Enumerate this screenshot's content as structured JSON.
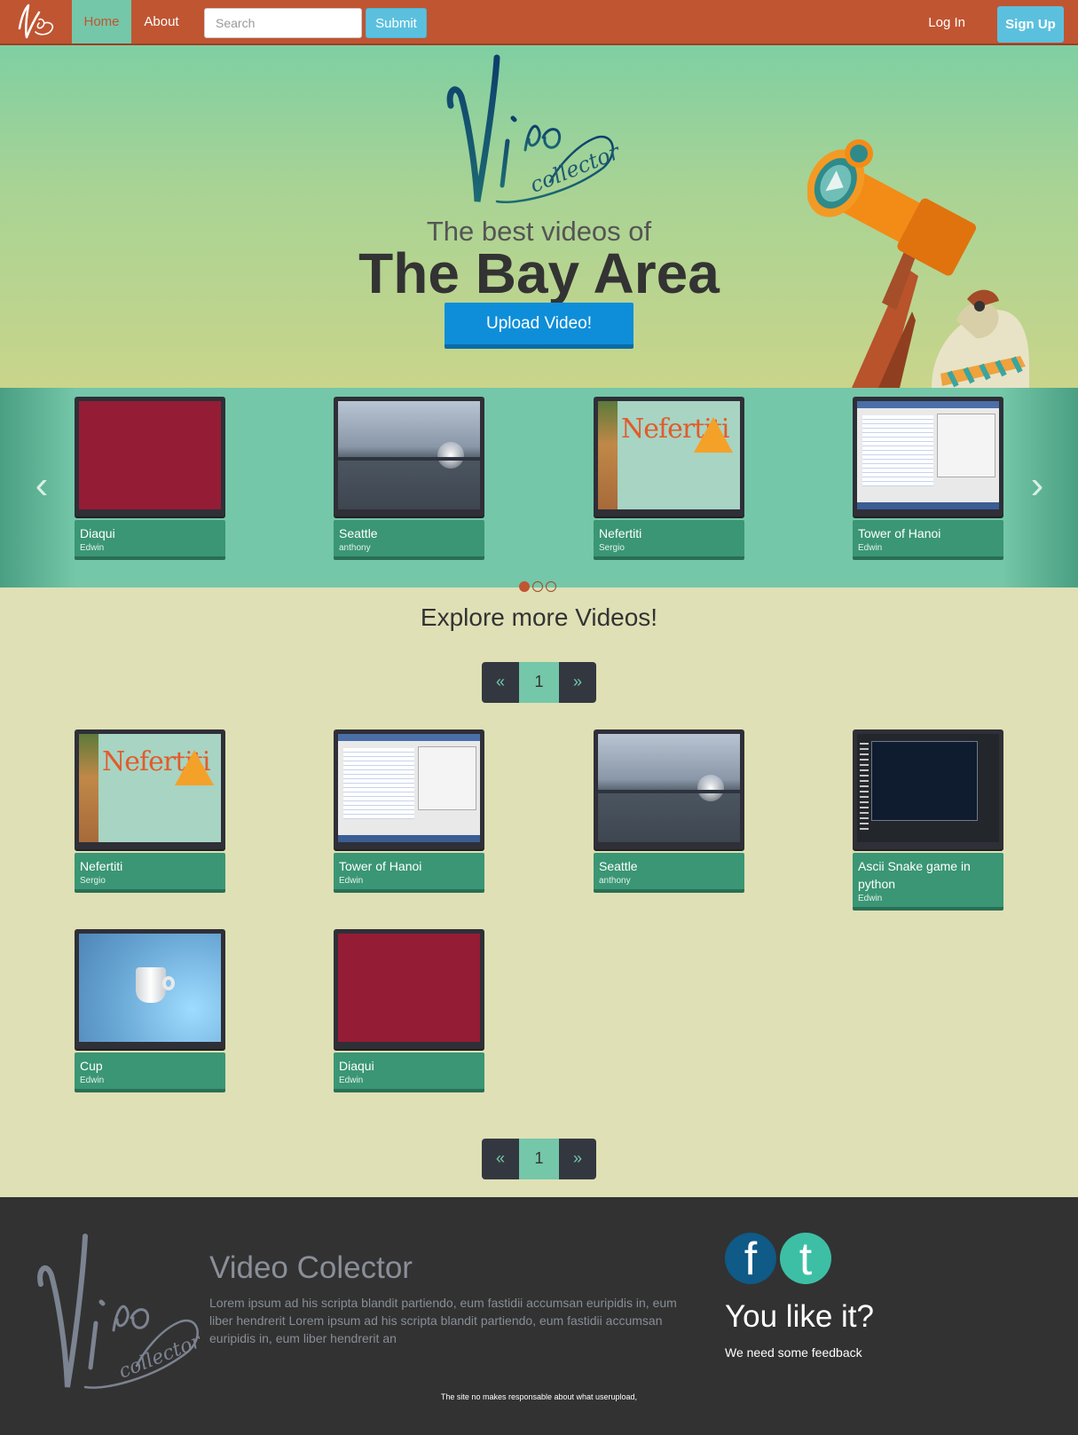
{
  "nav": {
    "home_label": "Home",
    "about_label": "About",
    "search_placeholder": "Search",
    "submit_label": "Submit",
    "login_label": "Log In",
    "signup_label": "Sign Up"
  },
  "hero": {
    "subtitle": "The best videos of",
    "title": "The Bay Area",
    "upload_label": "Upload Video!"
  },
  "carousel": {
    "items": [
      {
        "title": "Diaqui",
        "author": "Edwin",
        "thumb": "red"
      },
      {
        "title": "Seattle",
        "author": "anthony",
        "thumb": "lake"
      },
      {
        "title": "Nefertiti",
        "author": "Sergio",
        "thumb": "nefertiti"
      },
      {
        "title": "Tower of Hanoi",
        "author": "Edwin",
        "thumb": "code"
      }
    ],
    "active_dot": 1,
    "dot_count": 3
  },
  "explore": {
    "title": "Explore more Videos!",
    "pager": {
      "prev": "«",
      "current": "1",
      "next": "»"
    },
    "videos": [
      {
        "title": "Nefertiti",
        "author": "Sergio",
        "thumb": "nefertiti"
      },
      {
        "title": "Tower of Hanoi",
        "author": "Edwin",
        "thumb": "code"
      },
      {
        "title": "Seattle",
        "author": "anthony",
        "thumb": "lake"
      },
      {
        "title": "Ascii Snake game in python",
        "author": "Edwin",
        "thumb": "terminal"
      },
      {
        "title": "Cup",
        "author": "Edwin",
        "thumb": "cup"
      },
      {
        "title": "Diaqui",
        "author": "Edwin",
        "thumb": "red"
      }
    ]
  },
  "footer": {
    "title": "Video Colector",
    "text": "Lorem ipsum ad his scripta blandit partiendo, eum fastidii accumsan euripidis in, eum liber hendrerit Lorem ipsum ad his scripta blandit partiendo, eum fastidii accumsan euripidis in, eum liber hendrerit an",
    "like": "You like it?",
    "feedback": "We need some feedback",
    "note": "The site no makes responsable about what userupload,",
    "facebook_glyph": "f",
    "twitter_glyph": "t"
  },
  "colors": {
    "nav": "#c05532",
    "accent": "#74c7a8",
    "card": "#3a9674",
    "button": "#5bc0de",
    "upload": "#0e8ed9",
    "footer": "#323232"
  }
}
